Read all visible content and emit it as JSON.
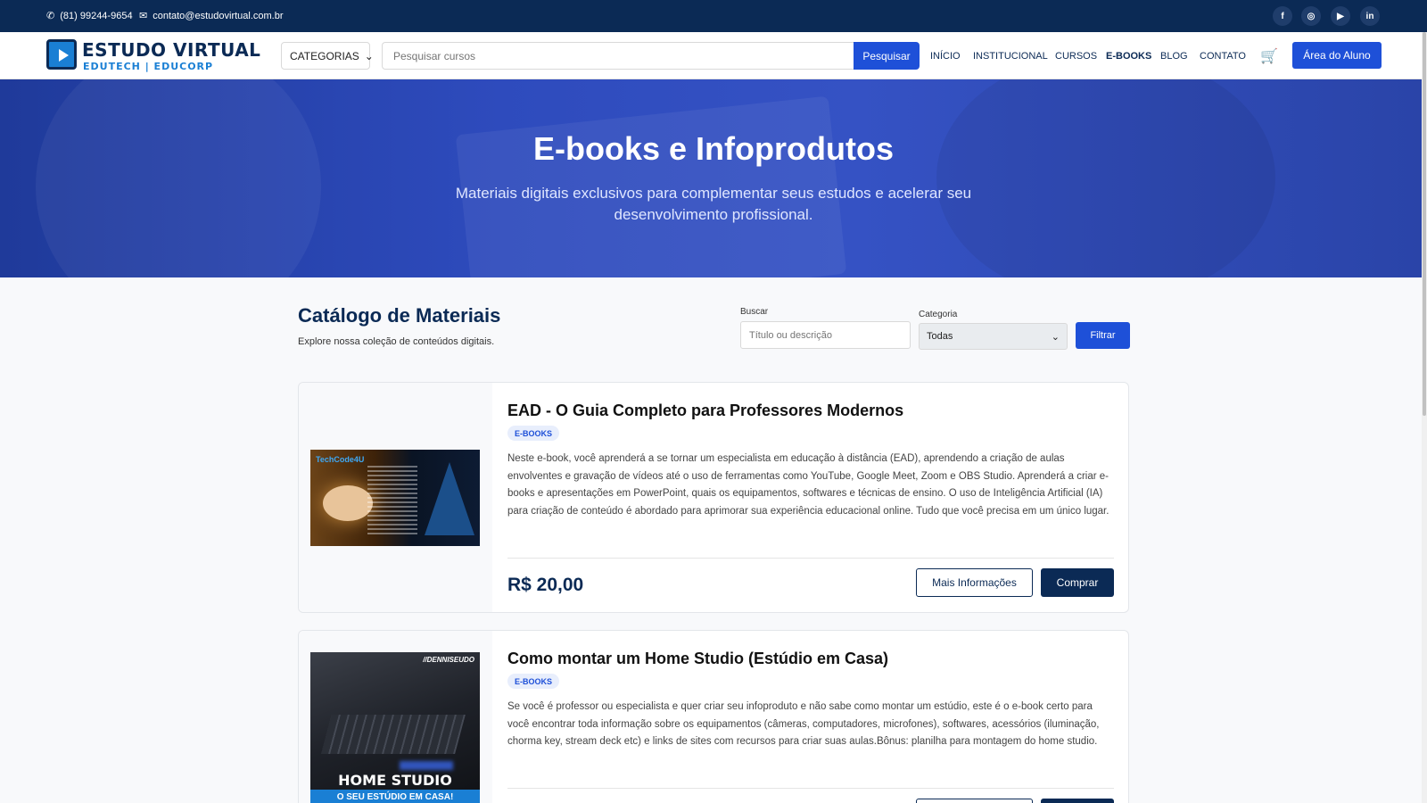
{
  "topbar": {
    "phone": "(81) 99244-9654",
    "email": "contato@estudovirtual.com.br",
    "social": [
      {
        "icon": "facebook-icon",
        "glyph": "f"
      },
      {
        "icon": "instagram-icon",
        "glyph": "◎"
      },
      {
        "icon": "youtube-icon",
        "glyph": "▶"
      },
      {
        "icon": "linkedin-icon",
        "glyph": "in"
      }
    ]
  },
  "header": {
    "logo_name": "ESTUDO VIRTUAL",
    "logo_tag": "EDUTECH | EDUCORP",
    "categories_label": "CATEGORIAS",
    "search_placeholder": "Pesquisar cursos",
    "search_button": "Pesquisar",
    "nav": [
      "INÍCIO",
      "INSTITUCIONAL",
      "CURSOS",
      "E-BOOKS",
      "BLOG",
      "CONTATO"
    ],
    "active_nav": "E-BOOKS",
    "cart_icon": "cart-icon",
    "student_area": "Área do Aluno"
  },
  "hero": {
    "title": "E-books e Infoprodutos",
    "subtitle": "Materiais digitais exclusivos para complementar seus estudos e acelerar seu desenvolvimento profissional."
  },
  "catalog": {
    "title": "Catálogo de Materiais",
    "subtitle": "Explore nossa coleção de conteúdos digitais.",
    "search_label": "Buscar",
    "search_placeholder": "Título ou descrição",
    "category_label": "Categoria",
    "category_value": "Todas",
    "filter_button": "Filtrar"
  },
  "products": [
    {
      "title": "EAD - O Guia Completo para Professores Modernos",
      "badge": "E-BOOKS",
      "description": "Neste e-book, você aprenderá a se tornar um especialista em educação à distância (EAD), aprendendo a criação de aulas envolventes e gravação de vídeos até o uso de ferramentas como YouTube, Google Meet, Zoom e OBS Studio. Aprenderá a criar e-books e apresentações em PowerPoint, quais os equipamentos, softwares e técnicas de ensino. O uso de Inteligência Artificial (IA) para criação de conteúdo é abordado para aprimorar sua experiência educacional online. Tudo que você precisa em um único lugar.",
      "price": "R$ 20,00",
      "info_button": "Mais Informações",
      "buy_button": "Comprar",
      "thumb_brand": "TechCode4U"
    },
    {
      "title": "Como montar um Home Studio (Estúdio em Casa)",
      "badge": "E-BOOKS",
      "description": "Se você é professor ou especialista e quer criar seu infoproduto e não sabe como montar um estúdio, este é o e-book certo para você encontrar toda informação sobre os equipamentos (câmeras, computadores, microfones), softwares, acessórios (iluminação, chorma key, stream deck etc) e links de sites com recursos para criar suas aulas.Bônus: planilha para montagem do home studio.",
      "thumb_brand": "//DENNISEUDO",
      "thumb_title": "HOME STUDIO",
      "thumb_strip": "O SEU ESTÚDIO EM CASA!"
    }
  ],
  "colors": {
    "navy": "#0b2a55",
    "accent_blue": "#1e50d8",
    "hero_blue": "#2e4bbd"
  }
}
